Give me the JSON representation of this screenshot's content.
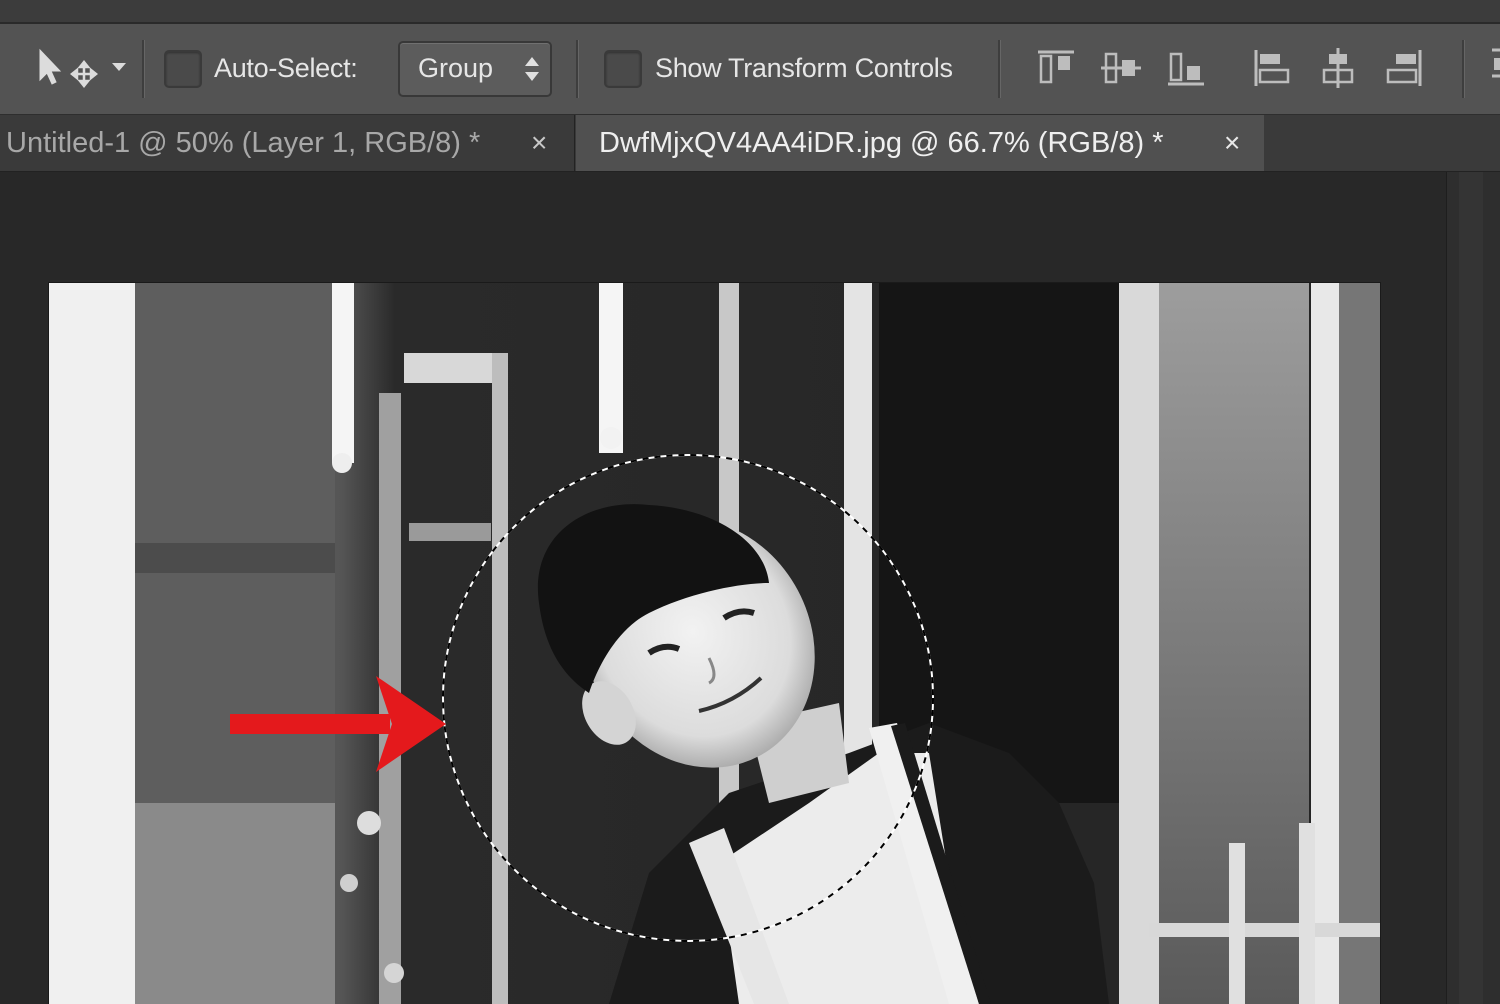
{
  "options_bar": {
    "auto_select_label": "Auto-Select:",
    "auto_select_value": "Group",
    "show_transform_label": "Show Transform Controls",
    "auto_select_checked": false,
    "show_transform_checked": false,
    "tool_icon": "move-tool-icon",
    "align_icons": [
      "align-top-edges-icon",
      "align-vertical-centers-icon",
      "align-bottom-edges-icon",
      "align-left-edges-icon",
      "align-horizontal-centers-icon",
      "align-right-edges-icon"
    ]
  },
  "tabs": [
    {
      "label": "Untitled-1 @ 50% (Layer 1, RGB/8) *",
      "close": "×",
      "active": false
    },
    {
      "label": "DwfMjxQV4AA4iDR.jpg @ 66.7% (RGB/8) *",
      "close": "×",
      "active": true
    }
  ],
  "document": {
    "content": "black-and-white photo of a smiling young man, circular selection around his head",
    "annotation": "red-arrow-icon",
    "selection_shape": "ellipse",
    "annotation_color": "#e4191c"
  },
  "colors": {
    "options_bar_bg": "#535353",
    "tab_active_bg": "#505050",
    "tab_inactive_bg": "#3a3a3a",
    "workspace_bg": "#282828",
    "arrow": "#e4191c"
  }
}
